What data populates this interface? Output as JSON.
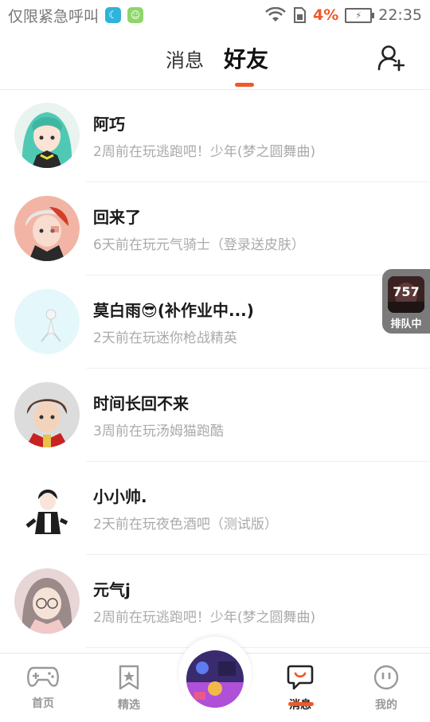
{
  "status_bar": {
    "carrier_text": "仅限紧急呼叫",
    "battery_percent": "4%",
    "time": "22:35",
    "icons": [
      "moon-icon",
      "app-notification-icon",
      "wifi-icon",
      "sim-icon",
      "battery-icon"
    ]
  },
  "header": {
    "tab_messages": "消息",
    "tab_friends": "好友",
    "active_tab": "好友",
    "add_friend_icon": "add-friend-icon"
  },
  "friends": [
    {
      "name": "阿巧",
      "status": "2周前在玩逃跑吧！少年(梦之圆舞曲)"
    },
    {
      "name": "回来了",
      "status": "6天前在玩元气骑士（登录送皮肤）"
    },
    {
      "name": "莫白雨😎(补作业中...)",
      "status": "2天前在玩迷你枪战精英"
    },
    {
      "name": "时间长回不来",
      "status": "3周前在玩汤姆猫跑酷"
    },
    {
      "name": "小小帅.",
      "status": "2天前在玩夜色酒吧（测试版）"
    },
    {
      "name": "元气j",
      "status": "2周前在玩逃跑吧！少年(梦之圆舞曲)"
    }
  ],
  "queue_widget": {
    "count": "757",
    "label": "排队中"
  },
  "bottom_nav": {
    "home": "首页",
    "picks": "精选",
    "messages": "消息",
    "me": "我的",
    "active": "消息"
  },
  "colors": {
    "accent": "#f0592b",
    "muted_text": "#aaaaaa"
  }
}
